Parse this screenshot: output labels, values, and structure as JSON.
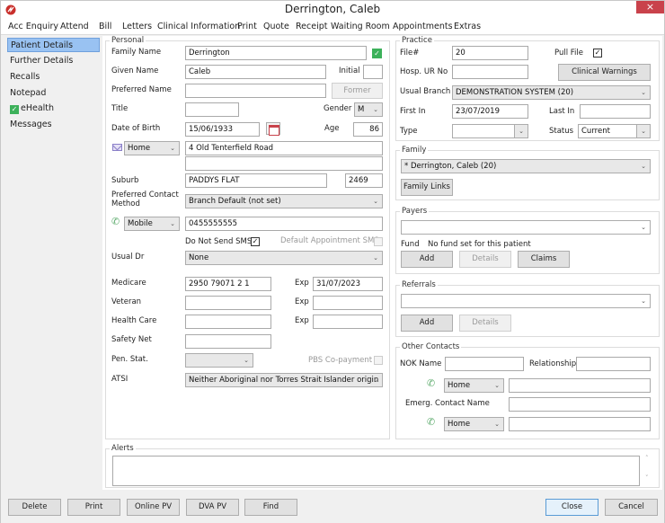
{
  "window": {
    "title": "Derrington, Caleb",
    "close_label": "×",
    "menu": [
      "Acc Enquiry",
      "Attend",
      "Bill",
      "Letters",
      "Clinical Information",
      "Print",
      "Quote",
      "Receipt",
      "Waiting Room",
      "Appointments",
      "Extras"
    ]
  },
  "sidebar": {
    "items": [
      {
        "label": "Patient Details",
        "active": true
      },
      {
        "label": "Further Details"
      },
      {
        "label": "Recalls"
      },
      {
        "label": "Notepad"
      },
      {
        "label": "eHealth",
        "icon": "check-icon"
      },
      {
        "label": "Messages"
      }
    ]
  },
  "personal": {
    "group_label": "Personal",
    "family_name_label": "Family Name",
    "family_name": "Derrington",
    "given_name_label": "Given Name",
    "given_name": "Caleb",
    "initial_label": "Initial",
    "initial": "",
    "preferred_name_label": "Preferred Name",
    "preferred_name": "",
    "former_button": "Former",
    "title_label": "Title",
    "title": "",
    "gender_label": "Gender",
    "gender": "M",
    "dob_label": "Date of Birth",
    "dob": "15/06/1933",
    "age_label": "Age",
    "age": "86",
    "address_type": "Home",
    "address_line1": "4 Old Tenterfield Road",
    "address_line2": "",
    "suburb_label": "Suburb",
    "suburb": "PADDYS FLAT",
    "postcode": "2469",
    "preferred_contact_label_1": "Preferred Contact",
    "preferred_contact_label_2": "Method",
    "preferred_contact": "Branch Default (not set)",
    "phone_type": "Mobile",
    "phone": "0455555555",
    "do_not_send_sms_label": "Do Not Send SMS",
    "do_not_send_sms": true,
    "default_appt_sms_label": "Default Appointment SMS",
    "default_appt_sms": false,
    "usual_dr_label": "Usual Dr",
    "usual_dr": "None",
    "medicare_label": "Medicare",
    "medicare": "2950 79071 2   1",
    "exp_label": "Exp",
    "medicare_exp": "31/07/2023",
    "veteran_label": "Veteran",
    "veteran": "",
    "veteran_exp": "",
    "health_care_label": "Health Care",
    "health_care": "",
    "health_care_exp": "",
    "safety_net_label": "Safety Net",
    "safety_net": "",
    "pen_stat_label": "Pen. Stat.",
    "pen_stat": "",
    "pbs_copayment_label": "PBS Co-payment",
    "pbs_copayment": false,
    "atsi_label": "ATSI",
    "atsi": "Neither Aboriginal nor Torres Strait Islander origin"
  },
  "practice": {
    "group_label": "Practice",
    "file_no_label": "File#",
    "file_no": "20",
    "pull_file_label": "Pull File",
    "pull_file": true,
    "hosp_ur_label": "Hosp. UR No",
    "hosp_ur": "",
    "clinical_warnings_button": "Clinical Warnings",
    "usual_branch_label": "Usual Branch",
    "usual_branch": "DEMONSTRATION SYSTEM  (20)",
    "first_in_label": "First In",
    "first_in": "23/07/2019",
    "last_in_label": "Last In",
    "last_in": "",
    "type_label": "Type",
    "type": "",
    "status_label": "Status",
    "status": "Current"
  },
  "family": {
    "group_label": "Family",
    "selected": "* Derrington, Caleb (20)",
    "links_button": "Family Links"
  },
  "payers": {
    "group_label": "Payers",
    "selected": "",
    "fund_label": "Fund",
    "fund_value": "No fund set for this patient",
    "add_button": "Add",
    "details_button": "Details",
    "claims_button": "Claims"
  },
  "referrals": {
    "group_label": "Referrals",
    "selected": "",
    "add_button": "Add",
    "details_button": "Details"
  },
  "other_contacts": {
    "group_label": "Other Contacts",
    "nok_name_label": "NOK Name",
    "nok_name": "",
    "relationship_label": "Relationship",
    "relationship": "",
    "nok_phone_type": "Home",
    "nok_phone": "",
    "emerg_label": "Emerg. Contact Name",
    "emerg_name": "",
    "emerg_phone_type": "Home",
    "emerg_phone": ""
  },
  "alerts": {
    "group_label": "Alerts",
    "text": ""
  },
  "footer": {
    "delete": "Delete",
    "print": "Print",
    "online_pv": "Online PV",
    "dva_pv": "DVA PV",
    "find": "Find",
    "close": "Close",
    "cancel": "Cancel"
  },
  "icons": {
    "chevron": "⌄",
    "check": "✓",
    "phone": "✆",
    "up": "˄",
    "down": "˅"
  },
  "colors": {
    "accent_selection": "#99c2f2",
    "close_button": "#c9424b",
    "ehealth_green": "#3cb15a"
  }
}
